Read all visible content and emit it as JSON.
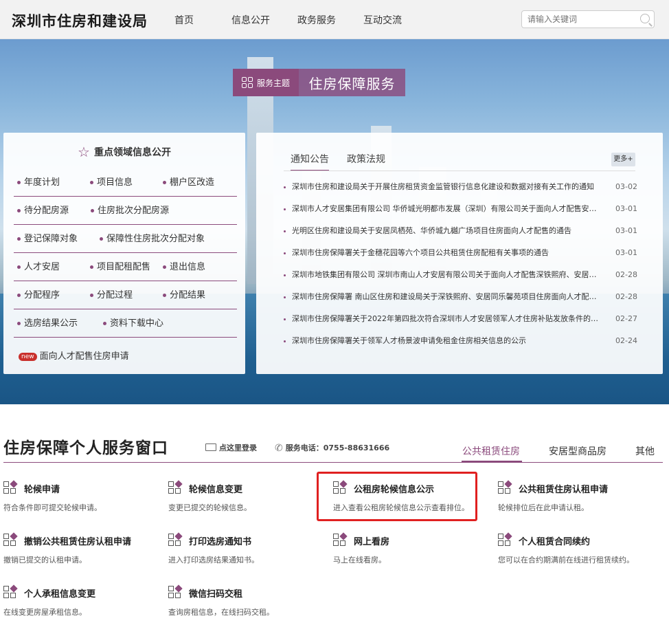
{
  "header": {
    "logo": "深圳市住房和建设局",
    "nav": [
      "首页",
      "信息公开",
      "政务服务",
      "互动交流"
    ],
    "search_placeholder": "请输入关键词"
  },
  "theme": {
    "badge_label": "服务主题",
    "title": "住房保障服务"
  },
  "key_info": {
    "title": "重点领域信息公开",
    "rows": [
      [
        "年度计划",
        "项目信息",
        "棚户区改造"
      ],
      [
        "待分配房源",
        "住房批次分配房源"
      ],
      [
        "登记保障对象",
        "保障性住房批次分配对象"
      ],
      [
        "人才安居",
        "项目配租配售",
        "退出信息"
      ],
      [
        "分配程序",
        "分配过程",
        "分配结果"
      ],
      [
        "选房结果公示",
        "资料下载中心"
      ]
    ],
    "new_badge": "new",
    "new_link": "面向人才配售住房申请"
  },
  "notices": {
    "tabs": [
      "通知公告",
      "政策法规"
    ],
    "more": "更多+",
    "items": [
      {
        "title": "深圳市住房和建设局关于开展住房租赁资金监管银行信息化建设和数据对接有关工作的通知",
        "date": "03-02"
      },
      {
        "title": "深圳市人才安居集团有限公司 华侨城光明都市发展（深圳）有限公司关于面向人才配售安居房的公告",
        "date": "03-01"
      },
      {
        "title": "光明区住房和建设局关于安居凤栖苑、华侨城九樾广场项目住房面向人才配售的通告",
        "date": "03-01"
      },
      {
        "title": "深圳市住房保障署关于金穗花园等六个项目公共租赁住房配租有关事项的通告",
        "date": "03-01"
      },
      {
        "title": "深圳市地铁集团有限公司 深圳市南山人才安居有限公司关于面向人才配售深铁熙府、安居同乐馨苑的公告",
        "date": "02-28"
      },
      {
        "title": "深圳市住房保障署 南山区住房和建设局关于深铁熙府、安居同乐馨苑项目住房面向人才配售的通告",
        "date": "02-28"
      },
      {
        "title": "深圳市住房保障署关于2022年第四批次符合深圳市人才安居领军人才住房补贴发放条件的公示",
        "date": "02-27"
      },
      {
        "title": "深圳市住房保障署关于领军人才杨景波申请免租金住房相关信息的公示",
        "date": "02-24"
      }
    ]
  },
  "services": {
    "title": "住房保障个人服务窗口",
    "login": "点这里登录",
    "phone": "服务电话：0755-88631666",
    "tabs": [
      "公共租赁住房",
      "安居型商品房",
      "其他"
    ],
    "items": [
      {
        "name": "轮候申请",
        "desc": "符合条件即可提交轮候申请。"
      },
      {
        "name": "轮候信息变更",
        "desc": "变更已提交的轮候信息。"
      },
      {
        "name": "公租房轮候信息公示",
        "desc": "进入查看公租房轮候信息公示查看排位。"
      },
      {
        "name": "公共租赁住房认租申请",
        "desc": "轮候排位后在此申请认租。"
      },
      {
        "name": "撤销公共租赁住房认租申请",
        "desc": "撤销已提交的认租申请。"
      },
      {
        "name": "打印选房通知书",
        "desc": "进入打印选房结果通知书。"
      },
      {
        "name": "网上看房",
        "desc": "马上在线看房。"
      },
      {
        "name": "个人租赁合同续约",
        "desc": "您可以在合约期满前在线进行租赁续约。"
      },
      {
        "name": "个人承租信息变更",
        "desc": "在线变更房屋承租信息。"
      },
      {
        "name": "微信扫码交租",
        "desc": "查询房租信息，在线扫码交租。"
      }
    ]
  },
  "colors": {
    "accent": "#8b4a7c",
    "highlight": "#e02020"
  }
}
